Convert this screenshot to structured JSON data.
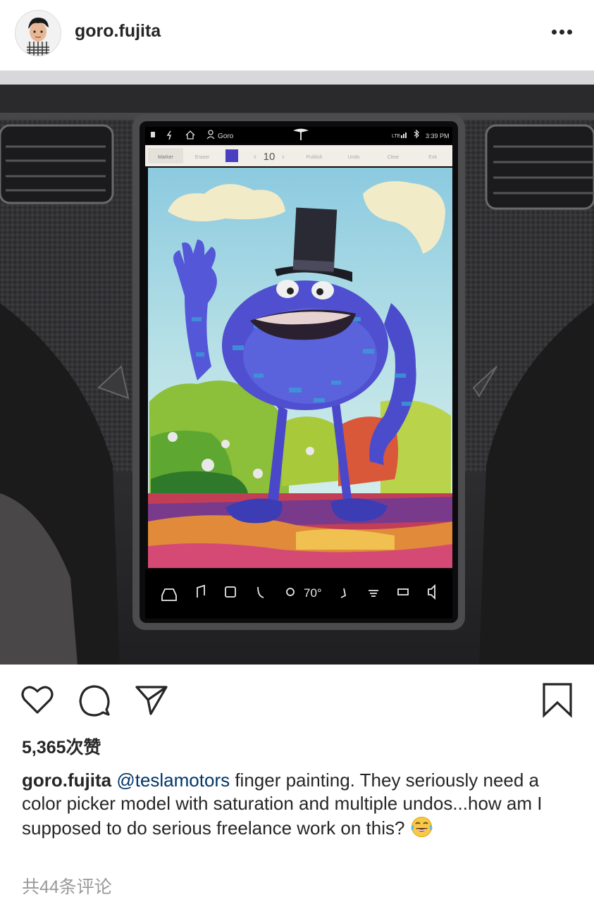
{
  "post": {
    "username": "goro.fujita",
    "likes": "5,365次赞",
    "caption_user": "goro.fujita",
    "caption_mention": "@teslamotors",
    "caption_text": " finger painting. They seriously need a color picker model with saturation and multiple undos...how am I supposed to do serious freelance work on this? ",
    "caption_emoji": "face-with-tears-of-joy",
    "view_comments": "共44条评论"
  },
  "tesla_screen": {
    "status": {
      "user": "Goro",
      "network": "LTE",
      "time": "3:39 PM"
    },
    "toolbar": {
      "marker": "Marker",
      "eraser": "Eraser",
      "brush_color": "#4a3fc0",
      "size": "10",
      "publish": "Publish",
      "undo": "Undo",
      "clear": "Clear",
      "exit": "Exit"
    },
    "dock": {
      "temperature": "70°"
    }
  },
  "icons": {
    "more": "more-dots-icon",
    "like": "heart-icon",
    "comment": "comment-bubble-icon",
    "share": "paper-plane-icon",
    "save": "bookmark-icon"
  }
}
